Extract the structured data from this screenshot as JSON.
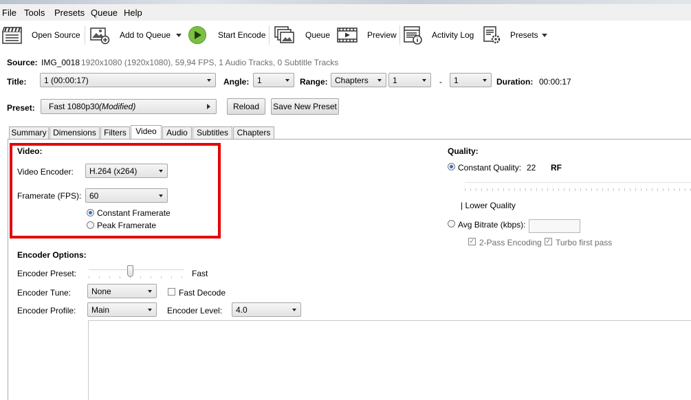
{
  "menu": [
    "File",
    "Tools",
    "Presets",
    "Queue",
    "Help"
  ],
  "toolbar": {
    "open_source": "Open Source",
    "add_to_queue": "Add to Queue",
    "start_encode": "Start Encode",
    "queue": "Queue",
    "preview": "Preview",
    "activity_log": "Activity Log",
    "presets": "Presets"
  },
  "source": {
    "label": "Source:",
    "name": "IMG_0018",
    "info": "1920x1080 (1920x1080), 59,94 FPS, 1 Audio Tracks, 0 Subtitle Tracks"
  },
  "title_row": {
    "title_label": "Title:",
    "title_value": "1  (00:00:17)",
    "angle_label": "Angle:",
    "angle_value": "1",
    "range_label": "Range:",
    "range_value": "Chapters",
    "range_start": "1",
    "range_dash": "-",
    "range_end": "1",
    "duration_label": "Duration:",
    "duration_value": "00:00:17"
  },
  "preset_row": {
    "label": "Preset:",
    "name": "Fast 1080p30",
    "modified": "(Modified)",
    "reload": "Reload",
    "save_new": "Save New Preset"
  },
  "tabs": [
    "Summary",
    "Dimensions",
    "Filters",
    "Video",
    "Audio",
    "Subtitles",
    "Chapters"
  ],
  "active_tab": "Video",
  "video": {
    "section": "Video:",
    "encoder_label": "Video Encoder:",
    "encoder_value": "H.264 (x264)",
    "framerate_label": "Framerate (FPS):",
    "framerate_value": "60",
    "constant_framerate": "Constant Framerate",
    "peak_framerate": "Peak Framerate"
  },
  "quality": {
    "section": "Quality:",
    "constant_quality": "Constant Quality:",
    "cq_value": "22",
    "cq_unit": "RF",
    "lower_quality": "| Lower Quality",
    "avg_bitrate": "Avg Bitrate (kbps):",
    "bitrate_value": "",
    "two_pass": "2-Pass Encoding",
    "turbo": "Turbo first pass"
  },
  "encoder_options": {
    "section": "Encoder Options:",
    "preset_label": "Encoder Preset:",
    "preset_value": "Fast",
    "tune_label": "Encoder Tune:",
    "tune_value": "None",
    "fast_decode": "Fast Decode",
    "profile_label": "Encoder Profile:",
    "profile_value": "Main",
    "level_label": "Encoder Level:",
    "level_value": "4.0"
  },
  "colors": {
    "highlight": "#e30000",
    "radio_selected": "#2a70c9"
  }
}
